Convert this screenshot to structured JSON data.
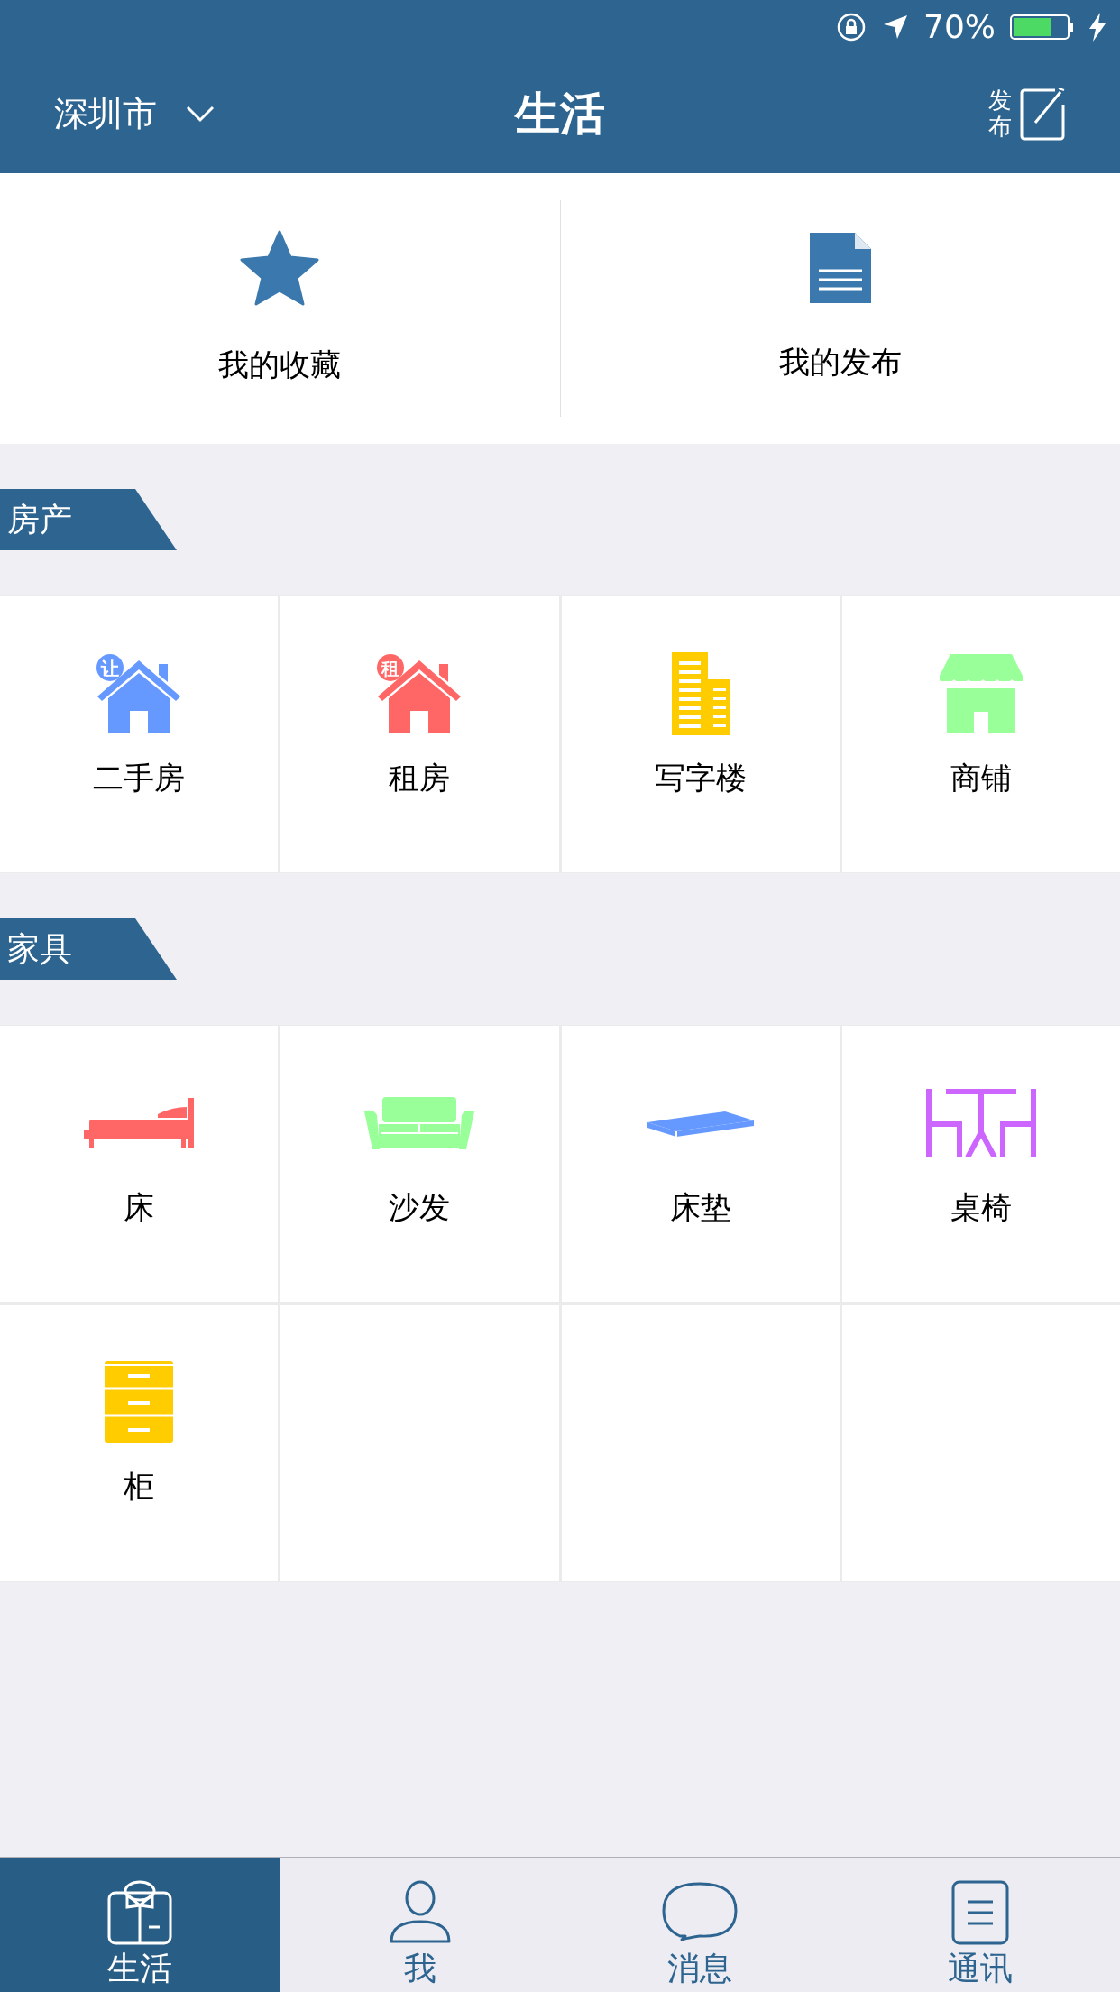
{
  "status_bar": {
    "battery": "70%"
  },
  "header": {
    "city": "深圳市",
    "title": "生活",
    "publish": "发布"
  },
  "shortcuts": [
    {
      "label": "我的收藏",
      "kind": "star"
    },
    {
      "label": "我的发布",
      "kind": "doc"
    }
  ],
  "sections": [
    {
      "title": "房产",
      "items": [
        {
          "label": "二手房",
          "kind": "house",
          "badge": "让",
          "color": "#6699ff"
        },
        {
          "label": "租房",
          "kind": "house",
          "badge": "租",
          "color": "#ff6666"
        },
        {
          "label": "写字楼",
          "kind": "office",
          "color": "#ffcc00"
        },
        {
          "label": "商铺",
          "kind": "shop",
          "color": "#99ff99"
        }
      ]
    },
    {
      "title": "家具",
      "items": [
        {
          "label": "床",
          "kind": "bed",
          "color": "#ff6666"
        },
        {
          "label": "沙发",
          "kind": "sofa",
          "color": "#99ff99"
        },
        {
          "label": "床垫",
          "kind": "mattress",
          "color": "#6699ff"
        },
        {
          "label": "桌椅",
          "kind": "table",
          "color": "#cc66ff"
        },
        {
          "label": "柜",
          "kind": "cabinet",
          "color": "#ffcc00"
        }
      ]
    }
  ],
  "tab_bar": [
    {
      "label": "生活",
      "kind": "shirt",
      "selected": true
    },
    {
      "label": "我",
      "kind": "person",
      "selected": false
    },
    {
      "label": "消息",
      "kind": "bubble",
      "selected": false
    },
    {
      "label": "通讯",
      "kind": "list",
      "selected": false
    }
  ]
}
